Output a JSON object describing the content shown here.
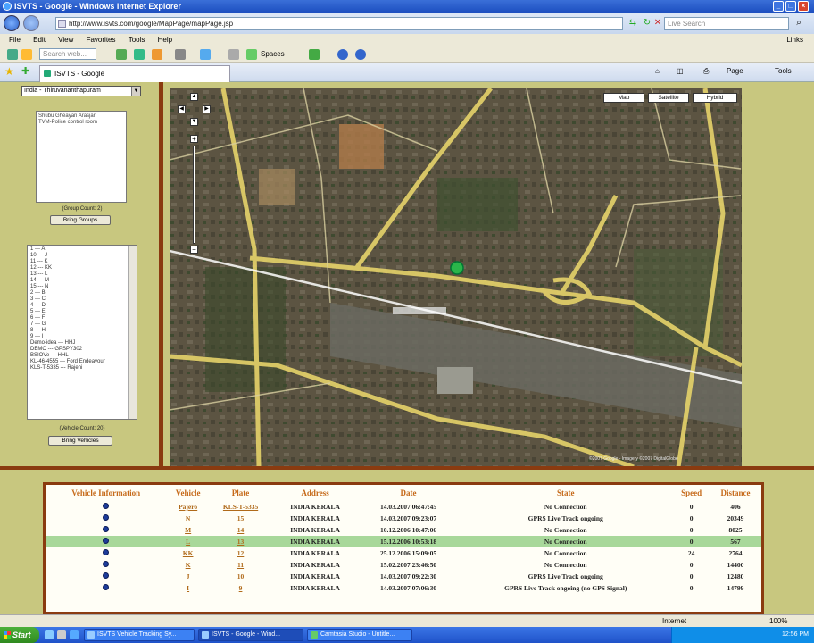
{
  "window": {
    "title": "ISVTS - Google - Windows Internet Explorer"
  },
  "address_bar": {
    "url": "http://www.isvts.com/google/MapPage/mapPage.jsp",
    "search_placeholder": "Live Search"
  },
  "menu": {
    "items": [
      "File",
      "Edit",
      "View",
      "Favorites",
      "Tools",
      "Help"
    ],
    "links": "Links"
  },
  "toolbar": {
    "search_placeholder": "Search web...",
    "spaces_label": "Spaces"
  },
  "tab": {
    "title": "ISVTS - Google"
  },
  "command_bar": {
    "page": "Page",
    "tools": "Tools"
  },
  "left_panel": {
    "city_select": "India - Thiruvananthapuram",
    "groups": [
      "Shubu Gheayan Arasjar",
      "TVM-Police control room"
    ],
    "group_count": "(Group Count: 2)",
    "bring_groups": "Bring Groups",
    "vehicles": [
      "1 --- A",
      "10 --- J",
      "11 --- K",
      "12 --- KK",
      "13 --- L",
      "14 --- M",
      "15 --- N",
      "2 --- B",
      "3 --- C",
      "4 --- D",
      "5 --- E",
      "6 --- F",
      "7 --- G",
      "8 --- H",
      "9 --- I",
      "Demo-idea --- HHJ",
      "DEMO --- GPSPY302",
      "BSIOVe --- HHL",
      "KL-46-4555 --- Ford Endeavour",
      "KLS-T-5335 --- Rajeni"
    ],
    "vehicle_count": "(Vehicle Count: 20)",
    "bring_vehicles": "Bring Vehicles"
  },
  "map": {
    "buttons": [
      "Map",
      "Satellite",
      "Hybrid"
    ],
    "copyright": "©2007 Google - Imagery ©2007 DigitalGlobe"
  },
  "table": {
    "headers": [
      "Vehicle Information",
      "Vehicle",
      "Plate",
      "Address",
      "Date",
      "State",
      "Speed",
      "Distance"
    ],
    "rows": [
      {
        "vehicle": "Pajero",
        "plate": "KLS-T-5335",
        "address": "INDIA KERALA",
        "date": "14.03.2007 06:47:45",
        "state": "No Connection",
        "speed": "0",
        "distance": "406"
      },
      {
        "vehicle": "N",
        "plate": "15",
        "address": "INDIA KERALA",
        "date": "14.03.2007 09:23:07",
        "state": "GPRS Live Track ongoing",
        "speed": "0",
        "distance": "20349"
      },
      {
        "vehicle": "M",
        "plate": "14",
        "address": "INDIA KERALA",
        "date": "10.12.2006 10:47:06",
        "state": "No Connection",
        "speed": "0",
        "distance": "8025"
      },
      {
        "vehicle": "L",
        "plate": "13",
        "address": "INDIA KERALA",
        "date": "15.12.2006 10:53:18",
        "state": "No Connection",
        "speed": "0",
        "distance": "567"
      },
      {
        "vehicle": "KK",
        "plate": "12",
        "address": "INDIA KERALA",
        "date": "25.12.2006 15:09:05",
        "state": "No Connection",
        "speed": "24",
        "distance": "2764"
      },
      {
        "vehicle": "K",
        "plate": "11",
        "address": "INDIA KERALA",
        "date": "15.02.2007 23:46:50",
        "state": "No Connection",
        "speed": "0",
        "distance": "14400"
      },
      {
        "vehicle": "J",
        "plate": "10",
        "address": "INDIA KERALA",
        "date": "14.03.2007 09:22:30",
        "state": "GPRS Live Track ongoing",
        "speed": "0",
        "distance": "12480"
      },
      {
        "vehicle": "I",
        "plate": "9",
        "address": "INDIA KERALA",
        "date": "14.03.2007 07:06:30",
        "state": "GPRS Live Track ongoing (no GPS Signal)",
        "speed": "0",
        "distance": "14799"
      }
    ]
  },
  "status_bar": {
    "zone": "Internet",
    "zoom": "100%"
  },
  "taskbar": {
    "start": "Start",
    "tasks": [
      "ISVTS Vehicle Tracking Sy...",
      "ISVTS - Google - Wind...",
      "Camtasia Studio - Untitle..."
    ],
    "clock": "12:56 PM"
  },
  "colors": {
    "accent": "#8a3b10",
    "panel": "#c8c77f",
    "selected_row": "#a8d89a",
    "header_link": "#c66a1a"
  }
}
